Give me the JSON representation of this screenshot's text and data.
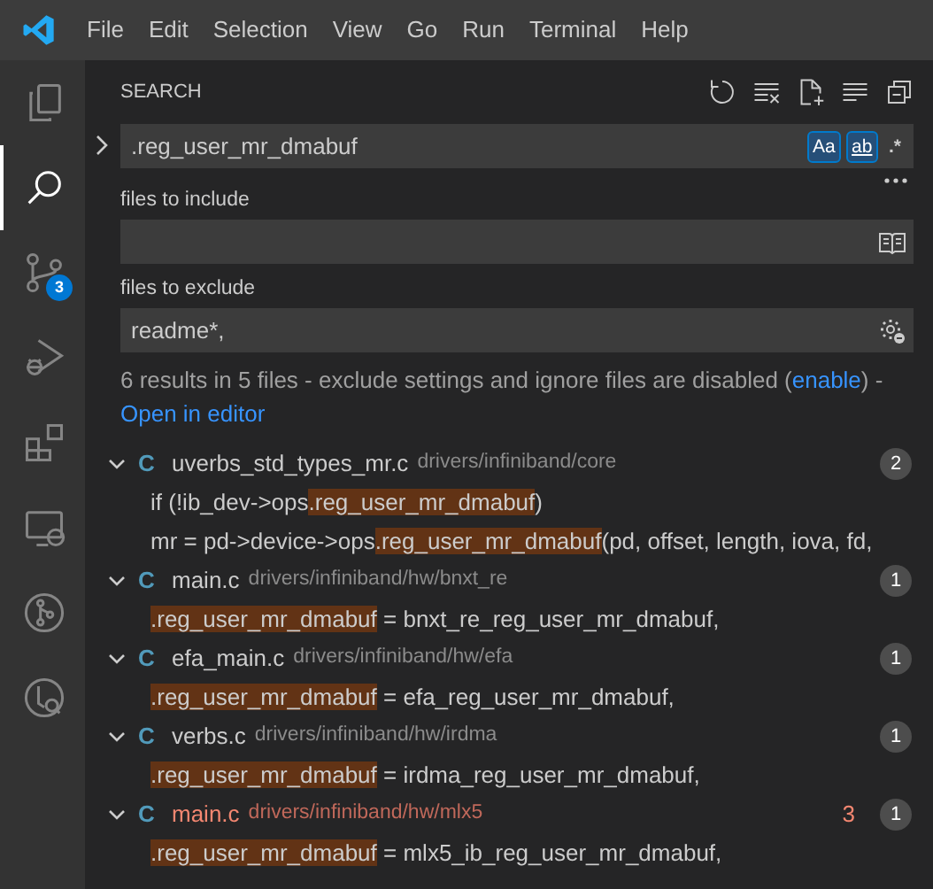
{
  "menu": [
    "File",
    "Edit",
    "Selection",
    "View",
    "Go",
    "Run",
    "Terminal",
    "Help"
  ],
  "activity_bar": [
    {
      "kind": "files",
      "selected": false
    },
    {
      "kind": "search",
      "selected": true
    },
    {
      "kind": "source-control",
      "selected": false,
      "badge": "3"
    },
    {
      "kind": "run",
      "selected": false
    },
    {
      "kind": "extensions",
      "selected": false
    },
    {
      "kind": "remote",
      "selected": false
    },
    {
      "kind": "graph",
      "selected": false
    },
    {
      "kind": "history",
      "selected": false
    }
  ],
  "sidebar": {
    "title": "SEARCH",
    "search": {
      "value": ".reg_user_mr_dmabuf",
      "expanded": false,
      "toggles": [
        {
          "label": "Aa",
          "selected": true
        },
        {
          "label": "ab",
          "selected": true
        },
        {
          "label": ".*",
          "selected": false
        }
      ]
    },
    "include": {
      "label": "files to include"
    },
    "exclude": {
      "label": "files to exclude",
      "value": "readme*,"
    },
    "summary": {
      "text": "6 results in 5 files - exclude settings and ignore files are disabled (",
      "link": "enable",
      "after": ") -",
      "open_link": "Open in editor"
    },
    "results": [
      {
        "icon": "C",
        "name": "uverbs_std_types_mr.c",
        "path": "drivers/infiniband/core",
        "count": "2",
        "error": false,
        "lines": [
          {
            "before": "if (!ib_dev->ops",
            "match": ".reg_user_mr_dmabuf",
            "after": ")"
          },
          {
            "before": "mr = pd->device->ops",
            "match": ".reg_user_mr_dmabuf",
            "after": "(pd, offset, length, iova, fd,"
          }
        ]
      },
      {
        "icon": "C",
        "name": "main.c",
        "path": "drivers/infiniband/hw/bnxt_re",
        "count": "1",
        "error": false,
        "lines": [
          {
            "match": ".reg_user_mr_dmabuf",
            "after": " = bnxt_re_reg_user_mr_dmabuf,"
          }
        ]
      },
      {
        "icon": "C",
        "name": "efa_main.c",
        "path": "drivers/infiniband/hw/efa",
        "count": "1",
        "error": false,
        "lines": [
          {
            "match": ".reg_user_mr_dmabuf",
            "after": " = efa_reg_user_mr_dmabuf,"
          }
        ]
      },
      {
        "icon": "C",
        "name": "verbs.c",
        "path": "drivers/infiniband/hw/irdma",
        "count": "1",
        "error": false,
        "lines": [
          {
            "match": ".reg_user_mr_dmabuf",
            "after": " = irdma_reg_user_mr_dmabuf,"
          }
        ]
      },
      {
        "icon": "C",
        "name": "main.c",
        "path": "drivers/infiniband/hw/mlx5",
        "count": "1",
        "error": true,
        "problems": "3",
        "lines": [
          {
            "match": ".reg_user_mr_dmabuf",
            "after": " = mlx5_ib_reg_user_mr_dmabuf,"
          }
        ]
      }
    ]
  }
}
